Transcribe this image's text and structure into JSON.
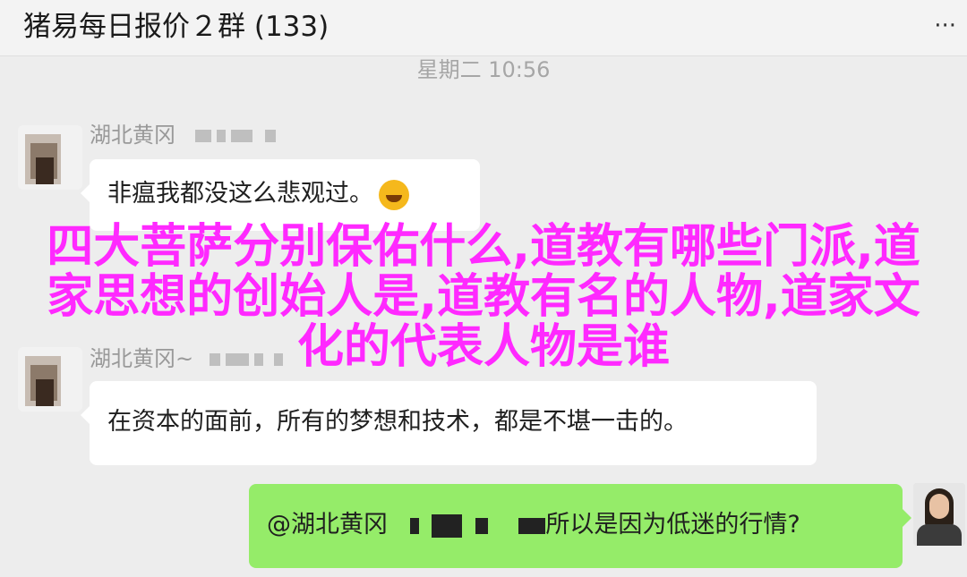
{
  "header": {
    "title": "猪易每日报价２群 (133)",
    "more_icon": "···"
  },
  "timestamp": "星期二 10:56",
  "messages": [
    {
      "sender": "湖北黄冈",
      "text": "非瘟我都没这么悲观过。",
      "emoji": "crying-laughing-emoji"
    },
    {
      "sender": "湖北黄冈~",
      "text": "在资本的面前，所有的梦想和技术，都是不堪一击的。"
    },
    {
      "text_prefix": "@湖北黄冈",
      "text": "所以是因为低迷的行情?"
    }
  ],
  "overlay": {
    "line1": "四大菩萨分别保佑什么,道教有哪些门派,道",
    "line2": "家思想的创始人是,道教有名的人物,道家文",
    "line3": "化的代表人物是谁",
    "color": "#ff29ff"
  },
  "colors": {
    "background": "#ededed",
    "incoming_bubble": "#ffffff",
    "outgoing_bubble": "#95ec69"
  }
}
